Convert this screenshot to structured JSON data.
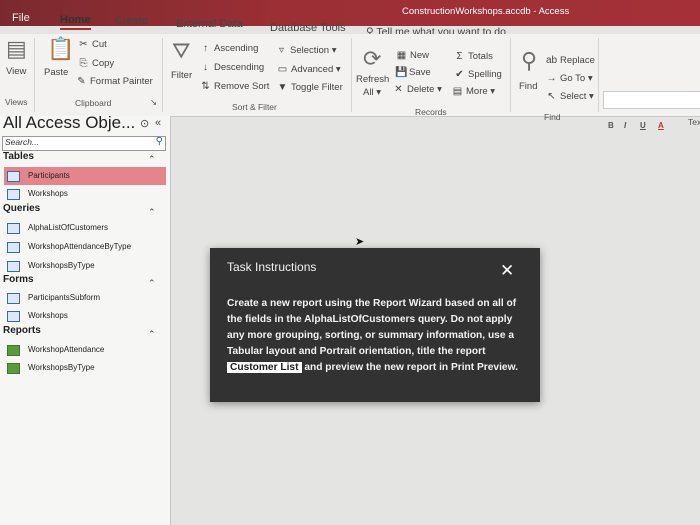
{
  "window": {
    "title": "ConstructionWorkshops.accdb - Access"
  },
  "tabs": [
    "File",
    "Home",
    "Create",
    "External Data",
    "Database Tools"
  ],
  "tell_me": "Tell me what you want to do",
  "ribbon": {
    "views": {
      "view_label": "View",
      "group_label": "Views"
    },
    "clipboard": {
      "paste_label": "Paste",
      "cut_label": "Cut",
      "copy_label": "Copy",
      "format_painter_label": "Format Painter",
      "group_label": "Clipboard"
    },
    "sort_filter": {
      "filter_label": "Filter",
      "ascending_label": "Ascending",
      "descending_label": "Descending",
      "remove_sort_label": "Remove Sort",
      "selection_label": "Selection",
      "advanced_label": "Advanced",
      "toggle_filter_label": "Toggle Filter",
      "group_label": "Sort & Filter"
    },
    "records": {
      "refresh_label": "Refresh",
      "refresh_all_label": "All",
      "new_label": "New",
      "save_label": "Save",
      "delete_label": "Delete",
      "totals_label": "Totals",
      "spelling_label": "Spelling",
      "more_label": "More",
      "group_label": "Records"
    },
    "find": {
      "find_label": "Find",
      "replace_label": "Replace",
      "goto_label": "Go To",
      "select_label": "Select",
      "group_label": "Find"
    },
    "text_format": {
      "bold": "B",
      "italic": "I",
      "underline": "U",
      "font_color": "A",
      "group_label": "Tex"
    }
  },
  "nav_pane": {
    "title": "All Access Obje...",
    "search_placeholder": "Search...",
    "groups": [
      {
        "name": "Tables",
        "items": [
          "Participants",
          "Workshops"
        ]
      },
      {
        "name": "Queries",
        "items": [
          "AlphaListOfCustomers",
          "WorkshopAttendanceByType",
          "WorkshopsByType"
        ]
      },
      {
        "name": "Forms",
        "items": [
          "ParticipantsSubform",
          "Workshops"
        ]
      },
      {
        "name": "Reports",
        "items": [
          "WorkshopAttendance",
          "WorkshopsByType"
        ]
      }
    ]
  },
  "dialog": {
    "title": "Task Instructions",
    "body_part1": "Create a new report using the Report Wizard based on all of the fields in the AlphaListOfCustomers query. Do not apply any more grouping, sorting, or summary information, use a Tabular layout and Portrait orientation, title the report",
    "highlight": "Customer List",
    "body_part2": "and preview the new report in Print Preview."
  },
  "colors": {
    "title_bar": "#9b2f35",
    "selected_item": "#e3858a",
    "dialog_bg": "#323232"
  }
}
